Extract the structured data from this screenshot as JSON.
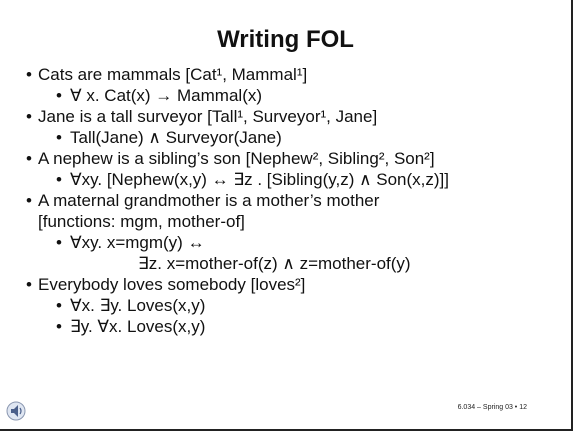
{
  "slide": {
    "title": "Writing FOL",
    "lines": [
      "Cats are mammals   [Cat¹, Mammal¹]",
      "∀ x. Cat(x) → Mammal(x)",
      "Jane is a tall surveyor [Tall¹, Surveyor¹, Jane]",
      "Tall(Jane) ∧ Surveyor(Jane)",
      "A nephew is a sibling’s son    [Nephew², Sibling², Son²]",
      "∀xy. [Nephew(x,y) ↔ ∃z . [Sibling(y,z) ∧ Son(x,z)]]",
      "A maternal grandmother is a mother’s mother",
      "[functions: mgm, mother-of]",
      "∀xy. x=mgm(y) ↔",
      "∃z. x=mother-of(z) ∧ z=mother-of(y)",
      "Everybody loves somebody [loves²]",
      "∀x. ∃y. Loves(x,y)",
      "∃y. ∀x. Loves(x,y)"
    ],
    "footer": "6.034 – Spring 03 • 12"
  }
}
